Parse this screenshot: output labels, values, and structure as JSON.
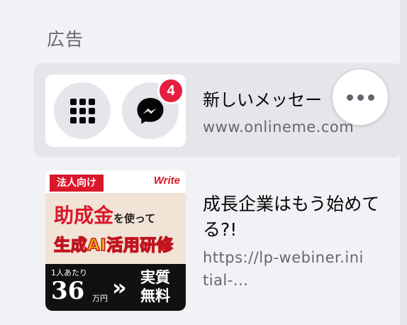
{
  "section": {
    "title": "広告"
  },
  "ads": [
    {
      "title": "新しいメッセー",
      "domain": "www.onlineme.com",
      "badge_count": "4"
    },
    {
      "title": "成長企業はもう始めてる?!",
      "domain": "https://lp-webiner.initial-...",
      "banner": {
        "tag": "法人向け",
        "brand": "Write",
        "headline_big": "助成金",
        "headline_small": "を使って",
        "subhead": "生成AI活用研修",
        "price_note": "1人あたり",
        "price_num": "36",
        "price_unit": "万円",
        "chevron": "»",
        "free_text": "実質無料"
      }
    }
  ],
  "more_button": {
    "icon": "more-horizontal-icon"
  },
  "colors": {
    "background": "#f0f2f5",
    "hover": "#e4e6ea",
    "badge": "#e41e3f",
    "text_secondary": "#65676b",
    "text_primary": "#050505"
  }
}
